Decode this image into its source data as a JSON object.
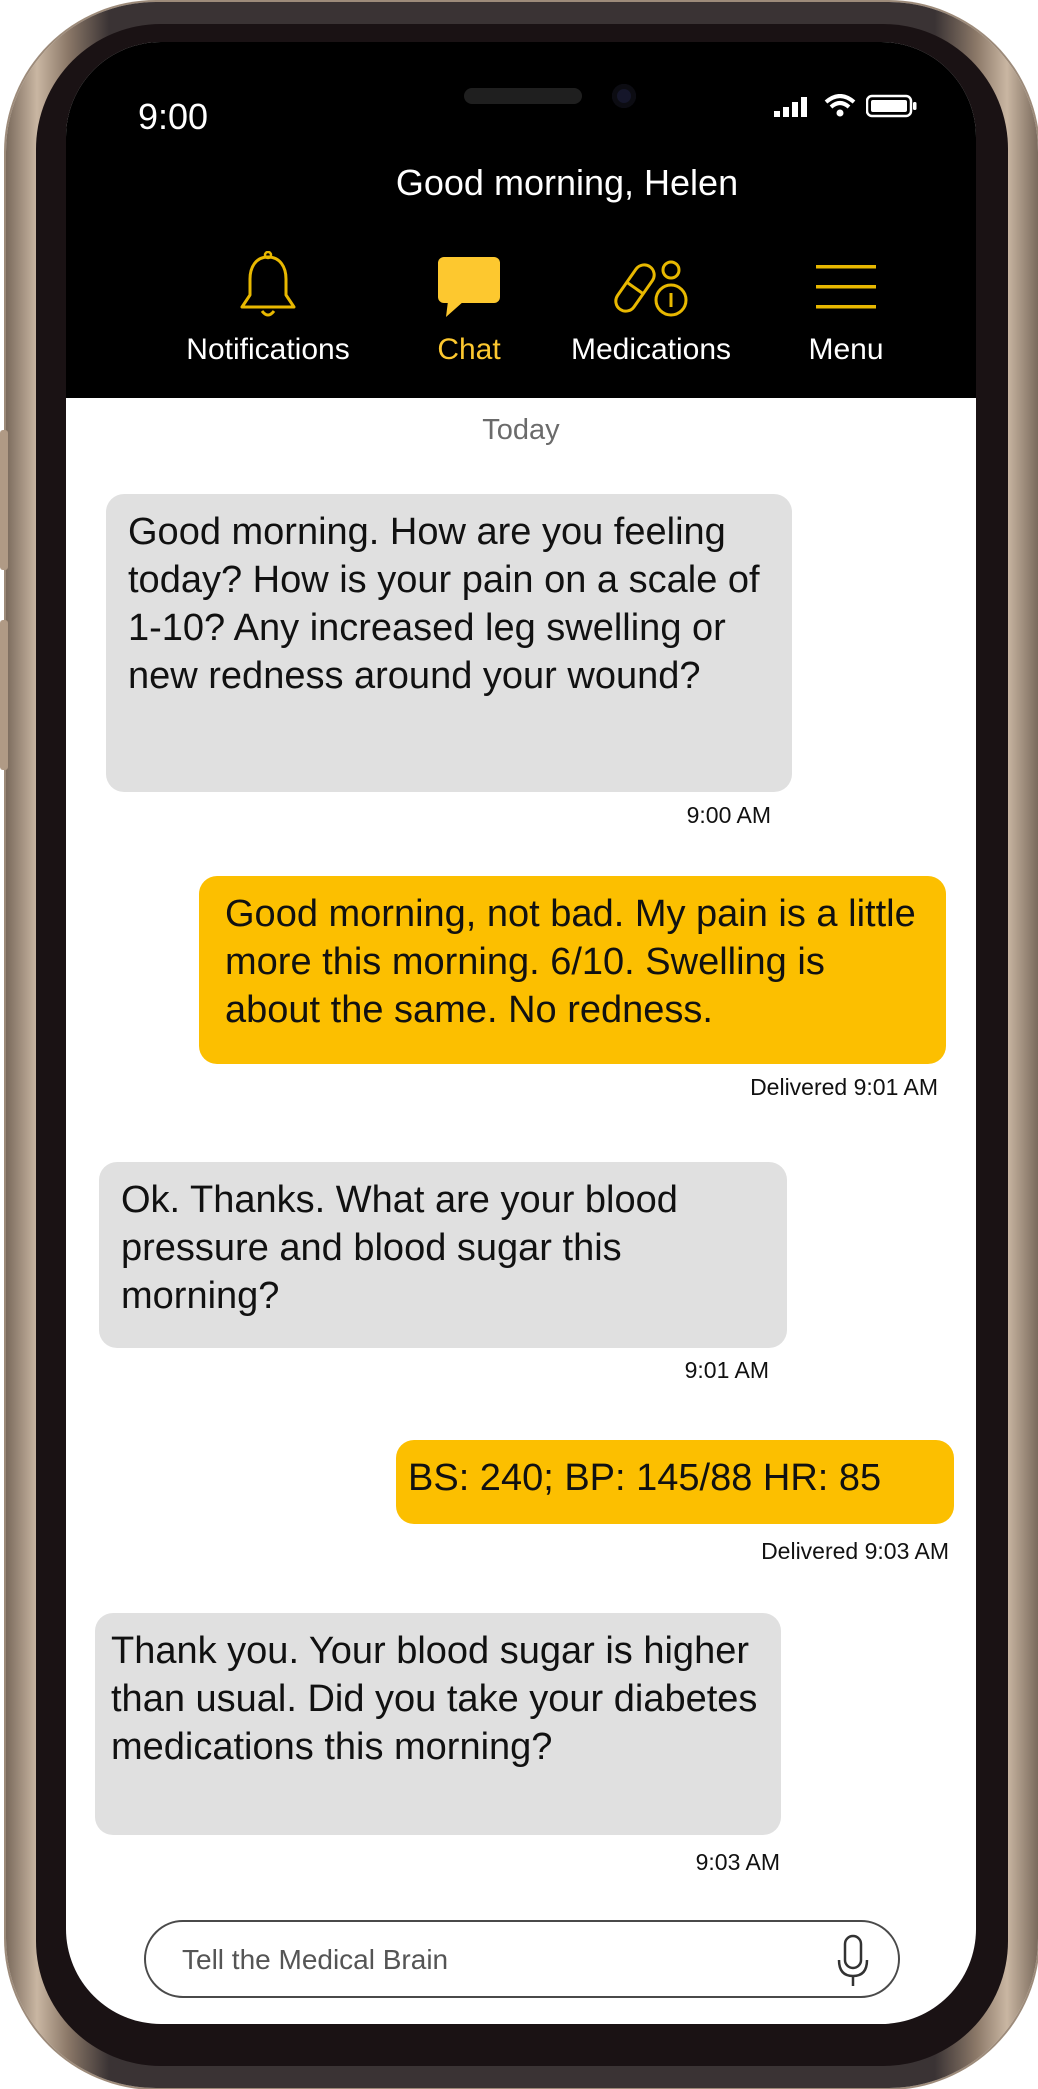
{
  "status_bar": {
    "time": "9:00"
  },
  "header": {
    "greeting": "Good morning, Helen"
  },
  "nav": [
    {
      "label": "Notifications",
      "icon": "bell-icon",
      "active": false
    },
    {
      "label": "Chat",
      "icon": "chat-icon",
      "active": true
    },
    {
      "label": "Medications",
      "icon": "pill-icon",
      "active": false
    },
    {
      "label": "Menu",
      "icon": "hamburger-icon",
      "active": false
    }
  ],
  "chat": {
    "day_label": "Today",
    "messages": [
      {
        "direction": "incoming",
        "text": "Good morning.  How are you feeling today? How is your pain on a scale of 1-10? Any increased leg swelling or new redness around your wound?",
        "meta": "9:00 AM"
      },
      {
        "direction": "outgoing",
        "text": "Good morning, not bad. My pain is a little more this morning. 6/10. Swelling is about the same. No redness.",
        "meta": "Delivered 9:01 AM"
      },
      {
        "direction": "incoming",
        "text": "Ok. Thanks. What are your blood pressure and blood sugar this morning?",
        "meta": "9:01 AM"
      },
      {
        "direction": "outgoing",
        "text": "BS: 240; BP: 145/88 HR: 85",
        "meta": "Delivered 9:03 AM"
      },
      {
        "direction": "incoming",
        "text": "Thank you. Your blood sugar is higher than usual.  Did you take your diabetes medications this morning?",
        "meta": "9:03 AM"
      }
    ]
  },
  "composer": {
    "placeholder": "Tell the Medical Brain"
  },
  "colors": {
    "accent": "#fcbf00",
    "nav_active": "#fdc82f",
    "incoming_bubble": "#e0e0e0",
    "header_bg": "#000000"
  }
}
